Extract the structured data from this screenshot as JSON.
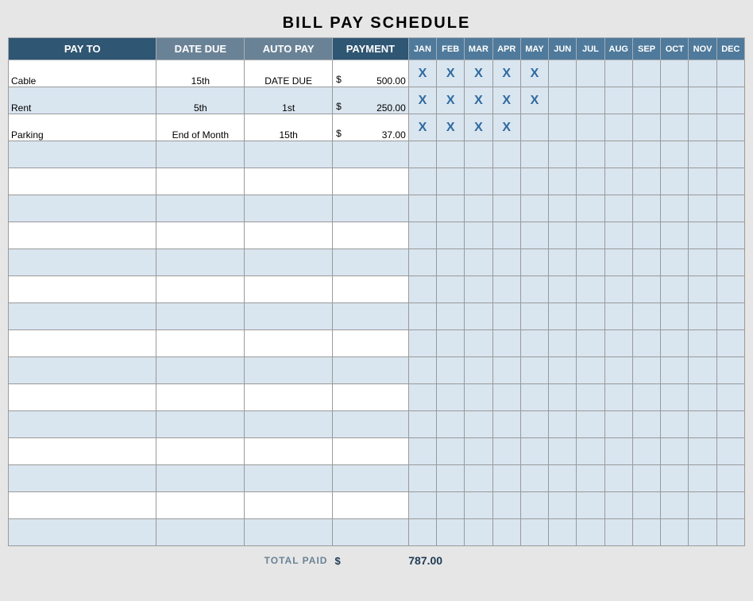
{
  "title": "BILL PAY SCHEDULE",
  "headers": {
    "pay_to": "PAY TO",
    "date_due": "DATE DUE",
    "auto_pay": "AUTO PAY",
    "payment": "PAYMENT"
  },
  "months": [
    "JAN",
    "FEB",
    "MAR",
    "APR",
    "MAY",
    "JUN",
    "JUL",
    "AUG",
    "SEP",
    "OCT",
    "NOV",
    "DEC"
  ],
  "currency": "$",
  "rows": [
    {
      "pay_to": "Cable",
      "date_due": "15th",
      "auto_pay": "DATE DUE",
      "payment": "500.00",
      "months": [
        "X",
        "X",
        "X",
        "X",
        "X",
        "",
        "",
        "",
        "",
        "",
        "",
        ""
      ]
    },
    {
      "pay_to": "Rent",
      "date_due": "5th",
      "auto_pay": "1st",
      "payment": "250.00",
      "months": [
        "X",
        "X",
        "X",
        "X",
        "X",
        "",
        "",
        "",
        "",
        "",
        "",
        ""
      ]
    },
    {
      "pay_to": "Parking",
      "date_due": "End of Month",
      "auto_pay": "15th",
      "payment": "37.00",
      "months": [
        "X",
        "X",
        "X",
        "X",
        "",
        "",
        "",
        "",
        "",
        "",
        "",
        ""
      ]
    },
    {
      "pay_to": "",
      "date_due": "",
      "auto_pay": "",
      "payment": "",
      "months": [
        "",
        "",
        "",
        "",
        "",
        "",
        "",
        "",
        "",
        "",
        "",
        ""
      ]
    },
    {
      "pay_to": "",
      "date_due": "",
      "auto_pay": "",
      "payment": "",
      "months": [
        "",
        "",
        "",
        "",
        "",
        "",
        "",
        "",
        "",
        "",
        "",
        ""
      ]
    },
    {
      "pay_to": "",
      "date_due": "",
      "auto_pay": "",
      "payment": "",
      "months": [
        "",
        "",
        "",
        "",
        "",
        "",
        "",
        "",
        "",
        "",
        "",
        ""
      ]
    },
    {
      "pay_to": "",
      "date_due": "",
      "auto_pay": "",
      "payment": "",
      "months": [
        "",
        "",
        "",
        "",
        "",
        "",
        "",
        "",
        "",
        "",
        "",
        ""
      ]
    },
    {
      "pay_to": "",
      "date_due": "",
      "auto_pay": "",
      "payment": "",
      "months": [
        "",
        "",
        "",
        "",
        "",
        "",
        "",
        "",
        "",
        "",
        "",
        ""
      ]
    },
    {
      "pay_to": "",
      "date_due": "",
      "auto_pay": "",
      "payment": "",
      "months": [
        "",
        "",
        "",
        "",
        "",
        "",
        "",
        "",
        "",
        "",
        "",
        ""
      ]
    },
    {
      "pay_to": "",
      "date_due": "",
      "auto_pay": "",
      "payment": "",
      "months": [
        "",
        "",
        "",
        "",
        "",
        "",
        "",
        "",
        "",
        "",
        "",
        ""
      ]
    },
    {
      "pay_to": "",
      "date_due": "",
      "auto_pay": "",
      "payment": "",
      "months": [
        "",
        "",
        "",
        "",
        "",
        "",
        "",
        "",
        "",
        "",
        "",
        ""
      ]
    },
    {
      "pay_to": "",
      "date_due": "",
      "auto_pay": "",
      "payment": "",
      "months": [
        "",
        "",
        "",
        "",
        "",
        "",
        "",
        "",
        "",
        "",
        "",
        ""
      ]
    },
    {
      "pay_to": "",
      "date_due": "",
      "auto_pay": "",
      "payment": "",
      "months": [
        "",
        "",
        "",
        "",
        "",
        "",
        "",
        "",
        "",
        "",
        "",
        ""
      ]
    },
    {
      "pay_to": "",
      "date_due": "",
      "auto_pay": "",
      "payment": "",
      "months": [
        "",
        "",
        "",
        "",
        "",
        "",
        "",
        "",
        "",
        "",
        "",
        ""
      ]
    },
    {
      "pay_to": "",
      "date_due": "",
      "auto_pay": "",
      "payment": "",
      "months": [
        "",
        "",
        "",
        "",
        "",
        "",
        "",
        "",
        "",
        "",
        "",
        ""
      ]
    },
    {
      "pay_to": "",
      "date_due": "",
      "auto_pay": "",
      "payment": "",
      "months": [
        "",
        "",
        "",
        "",
        "",
        "",
        "",
        "",
        "",
        "",
        "",
        ""
      ]
    },
    {
      "pay_to": "",
      "date_due": "",
      "auto_pay": "",
      "payment": "",
      "months": [
        "",
        "",
        "",
        "",
        "",
        "",
        "",
        "",
        "",
        "",
        "",
        ""
      ]
    },
    {
      "pay_to": "",
      "date_due": "",
      "auto_pay": "",
      "payment": "",
      "months": [
        "",
        "",
        "",
        "",
        "",
        "",
        "",
        "",
        "",
        "",
        "",
        ""
      ]
    }
  ],
  "total": {
    "label": "TOTAL PAID",
    "value": "787.00"
  },
  "chart_data": {
    "type": "table",
    "title": "BILL PAY SCHEDULE",
    "columns": [
      "PAY TO",
      "DATE DUE",
      "AUTO PAY",
      "PAYMENT",
      "JAN",
      "FEB",
      "MAR",
      "APR",
      "MAY",
      "JUN",
      "JUL",
      "AUG",
      "SEP",
      "OCT",
      "NOV",
      "DEC"
    ],
    "rows": [
      [
        "Cable",
        "15th",
        "DATE DUE",
        500.0,
        "X",
        "X",
        "X",
        "X",
        "X",
        "",
        "",
        "",
        "",
        "",
        "",
        ""
      ],
      [
        "Rent",
        "5th",
        "1st",
        250.0,
        "X",
        "X",
        "X",
        "X",
        "X",
        "",
        "",
        "",
        "",
        "",
        "",
        ""
      ],
      [
        "Parking",
        "End of Month",
        "15th",
        37.0,
        "X",
        "X",
        "X",
        "X",
        "",
        "",
        "",
        "",
        "",
        "",
        "",
        ""
      ]
    ],
    "total_paid": 787.0
  }
}
